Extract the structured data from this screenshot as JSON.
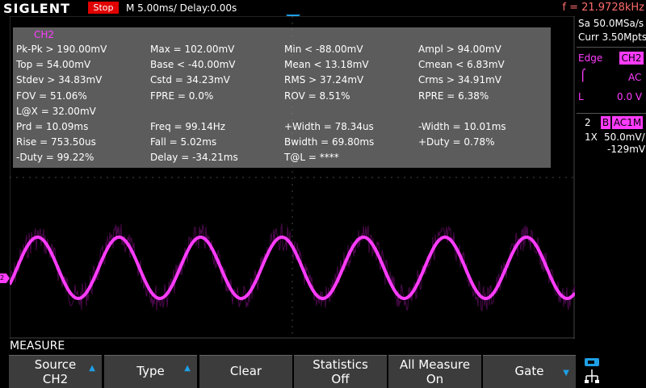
{
  "brand": "SIGLENT",
  "header": {
    "run_state": "Stop",
    "timebase": "M 5.00ms/ Delay:0.00s",
    "trigger_freq": "f = 21.9728kHz"
  },
  "measure_panel": {
    "source": "CH2",
    "rows": [
      [
        "Pk-Pk > 190.00mV",
        "Max = 102.00mV",
        "Min < -88.00mV",
        "Ampl > 94.00mV"
      ],
      [
        "Top = 54.00mV",
        "Base < -40.00mV",
        "Mean < 13.18mV",
        "Cmean < 6.83mV"
      ],
      [
        "Stdev > 34.83mV",
        "Cstd = 34.23mV",
        "RMS > 37.24mV",
        "Crms > 34.91mV"
      ],
      [
        "FOV = 51.06%",
        "FPRE = 0.0%",
        "ROV = 8.51%",
        "RPRE = 6.38%"
      ],
      [
        "L@X = 32.00mV",
        "",
        "",
        ""
      ],
      [
        "Prd = 10.09ms",
        "Freq = 99.14Hz",
        "+Width = 78.34us",
        "-Width = 10.01ms"
      ],
      [
        "Rise = 753.50us",
        "Fall = 5.02ms",
        "Bwidth = 69.80ms",
        "+Duty = 0.78%"
      ],
      [
        "-Duty = 99.22%",
        "Delay = -34.21ms",
        "T@L = ****",
        ""
      ]
    ]
  },
  "right_panel": {
    "sample_rate": "Sa 50.0MSa/s",
    "memory_depth": "Curr 3.50Mpts",
    "trigger_type": "Edge",
    "trigger_source": "CH2",
    "trigger_coupling": "AC",
    "trigger_level_label": "L",
    "trigger_level": "0.0 V",
    "ch_number": "2",
    "ch_bw": "B",
    "ch_coupling": "AC1M",
    "ch_probe": "1X",
    "ch_scale": "50.0mV/",
    "ch_offset": "-129mV"
  },
  "ch2_marker": "2",
  "menu_title": "MEASURE",
  "softkeys": [
    {
      "line1": "Source",
      "line2": "CH2",
      "arrow": "up"
    },
    {
      "line1": "Type",
      "line2": "",
      "arrow": "up"
    },
    {
      "line1": "Clear",
      "line2": "",
      "arrow": ""
    },
    {
      "line1": "Statistics",
      "line2": "Off",
      "arrow": ""
    },
    {
      "line1": "All Measure",
      "line2": "On",
      "arrow": ""
    },
    {
      "line1": "Gate",
      "line2": "",
      "arrow": "down"
    }
  ],
  "colors": {
    "ch2": "#ff3cff",
    "stop": "#e00000",
    "trigger_marker": "#1ea0e6",
    "freq": "#ff6b6b"
  }
}
